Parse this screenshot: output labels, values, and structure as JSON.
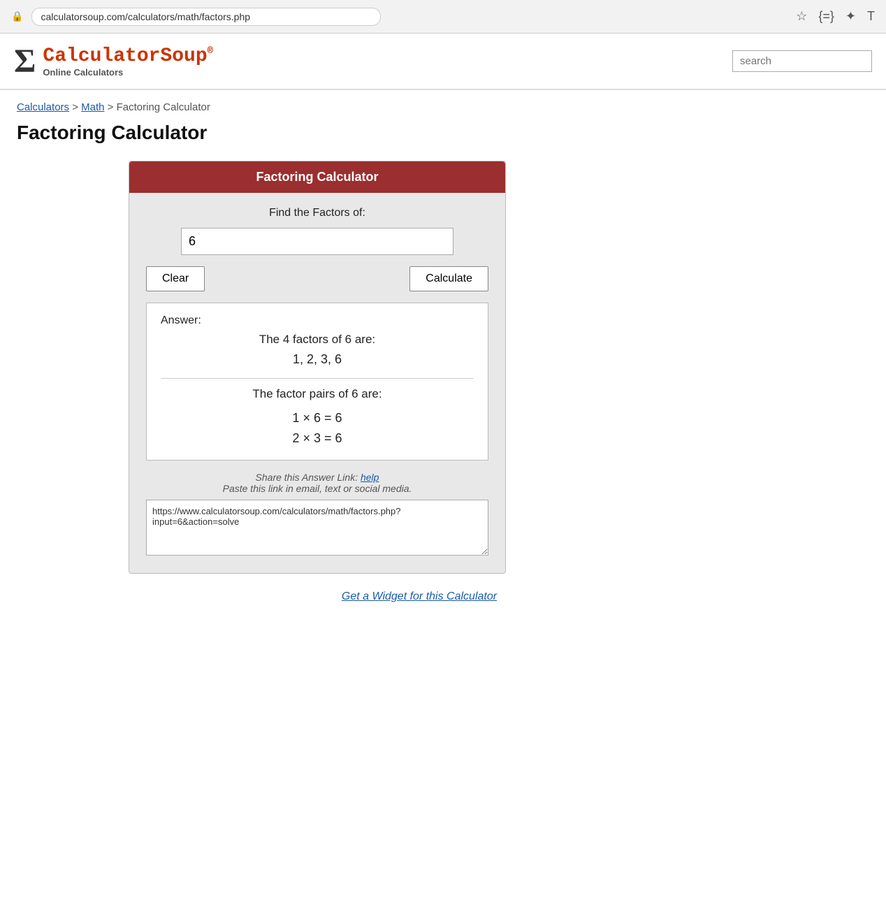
{
  "browser": {
    "url": "calculatorsoup.com/calculators/math/factors.php",
    "search_placeholder": "search"
  },
  "header": {
    "logo_symbol": "Σ",
    "logo_name_black": "Calculator",
    "logo_name_red": "Soup",
    "logo_reg": "®",
    "logo_subtitle": "Online Calculators",
    "search_placeholder": "search"
  },
  "breadcrumb": {
    "calculators": "Calculators",
    "sep1": ">",
    "math": "Math",
    "sep2": ">",
    "current": "Factoring Calculator"
  },
  "page": {
    "title": "Factoring Calculator"
  },
  "calculator": {
    "widget_title": "Factoring Calculator",
    "input_label": "Find the Factors of:",
    "input_value": "6",
    "clear_label": "Clear",
    "calculate_label": "Calculate",
    "answer_label": "Answer:",
    "factors_title": "The 4 factors of 6 are:",
    "factors_list": "1, 2, 3, 6",
    "pairs_title": "The factor pairs of 6 are:",
    "pair1": "1 × 6 = 6",
    "pair2": "2 × 3 = 6",
    "share_text": "Share this Answer Link:",
    "share_help": "help",
    "share_paste": "Paste this link in email, text or social media.",
    "share_url": "https://www.calculatorsoup.com/calculators/math/factors.php?input=6&action=solve",
    "widget_link": "Get a Widget for this Calculator"
  }
}
